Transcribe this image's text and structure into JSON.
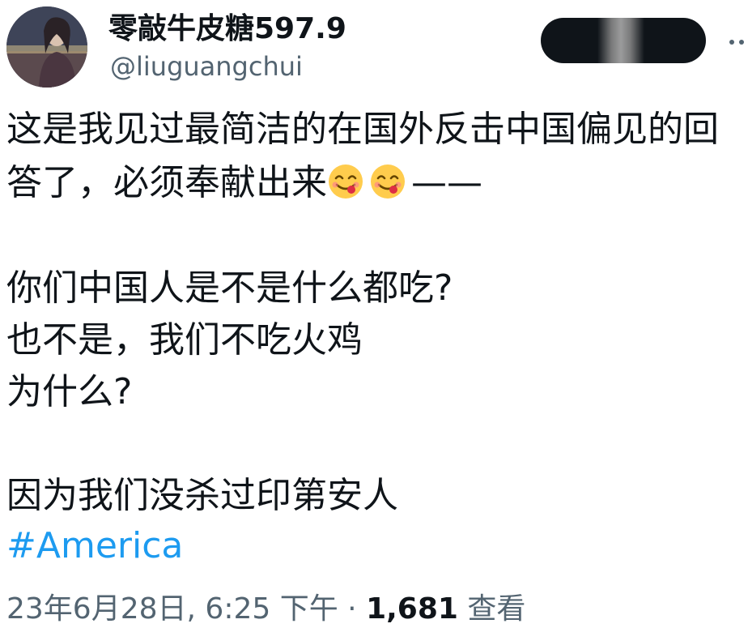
{
  "author": {
    "display_name": "零敲牛皮糖597.9",
    "handle": "@liuguangchui",
    "avatar_icon": "user-avatar-photo"
  },
  "follow_button": {
    "label": "",
    "background": "#0f1419"
  },
  "tweet": {
    "line1": "这是我见过最简洁的在国外反击中国偏见的回",
    "line2_text": "答了，必须奉献出来",
    "line2_tail": "——",
    "emojis": [
      "face-savoring-food-icon",
      "face-savoring-food-icon"
    ],
    "line3": "你们中国人是不是什么都吃?",
    "line4": "也不是，我们不吃火鸡",
    "line5": "为什么?",
    "line6": "因为我们没杀过印第安人",
    "hashtag": "#America"
  },
  "meta": {
    "timestamp": "23年6月28日, 6:25 下午",
    "separator": "·",
    "views_count": "1,681",
    "views_label": "查看"
  },
  "colors": {
    "text": "#0f1419",
    "secondary": "#536471",
    "link": "#1d9bf0"
  }
}
